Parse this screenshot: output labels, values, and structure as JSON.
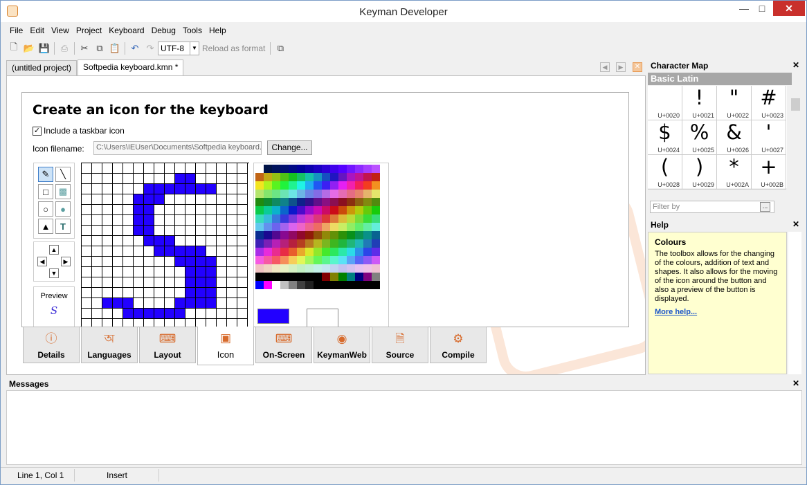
{
  "window": {
    "title": "Keyman Developer"
  },
  "menu": [
    "File",
    "Edit",
    "View",
    "Project",
    "Keyboard",
    "Debug",
    "Tools",
    "Help"
  ],
  "toolbar": {
    "encoding": "UTF-8",
    "reload_label": "Reload as format"
  },
  "doc_tabs": [
    "(untitled project)",
    "Softpedia keyboard.kmn *"
  ],
  "icon_page": {
    "heading": "Create an icon for the keyboard",
    "include_taskbar_label": "Include a taskbar icon",
    "include_taskbar_checked": true,
    "filename_label": "Icon filename:",
    "filename_value": "C:\\Users\\IEUser\\Documents\\Softpedia keyboard.",
    "change_button": "Change...",
    "preview_label": "Preview",
    "preview_glyph": "S",
    "fg_color": "#2200ff"
  },
  "bottom_tabs": [
    {
      "label": "Details",
      "icon": "info-icon"
    },
    {
      "label": "Languages",
      "icon": "script-glyph-icon"
    },
    {
      "label": "Layout",
      "icon": "keyboard-icon"
    },
    {
      "label": "Icon",
      "icon": "icon-editor-icon",
      "active": true
    },
    {
      "label": "On-Screen",
      "icon": "onscreen-keyboard-icon"
    },
    {
      "label": "KeymanWeb",
      "icon": "globe-icon"
    },
    {
      "label": "Source",
      "icon": "document-icon"
    },
    {
      "label": "Compile",
      "icon": "gear-icon"
    }
  ],
  "character_map": {
    "title": "Character Map",
    "block": "Basic Latin",
    "chars": [
      {
        "g": " ",
        "u": "U+0020"
      },
      {
        "g": "!",
        "u": "U+0021"
      },
      {
        "g": "\"",
        "u": "U+0022"
      },
      {
        "g": "#",
        "u": "U+0023"
      },
      {
        "g": "$",
        "u": "U+0024"
      },
      {
        "g": "%",
        "u": "U+0025"
      },
      {
        "g": "&",
        "u": "U+0026"
      },
      {
        "g": "'",
        "u": "U+0027"
      },
      {
        "g": "(",
        "u": "U+0028"
      },
      {
        "g": ")",
        "u": "U+0029"
      },
      {
        "g": "*",
        "u": "U+002A"
      },
      {
        "g": "+",
        "u": "U+002B"
      }
    ],
    "filter_placeholder": "Filter by"
  },
  "help": {
    "title": "Help",
    "topic": "Colours",
    "body": "The toolbox allows for the changing of the colours, addition of text and shapes. It also allows for the moving of the icon around the button and also a preview of the button is displayed.",
    "more_link": "More help..."
  },
  "messages": {
    "title": "Messages"
  },
  "status": {
    "position": "Line 1, Col 1",
    "mode": "Insert"
  }
}
